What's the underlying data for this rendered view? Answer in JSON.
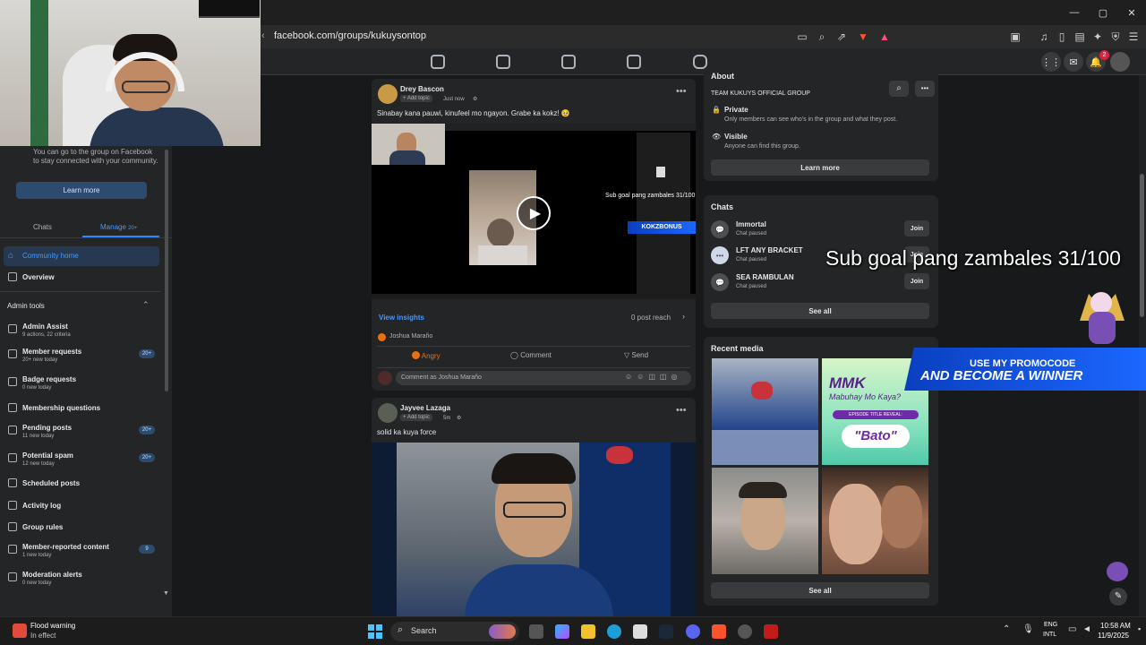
{
  "browser": {
    "url": "facebook.com/groups/kukuysontop",
    "url_lead": "‹",
    "window_controls": [
      "—",
      "▢",
      "✕"
    ],
    "ext_badge": "1"
  },
  "header": {
    "notif_count": "2"
  },
  "sidebar": {
    "info_text": "You can go to the group on Facebook to stay connected with your community.",
    "learn_more": "Learn more",
    "tabs": [
      {
        "label": "Chats"
      },
      {
        "label": "Manage",
        "count": "20+"
      }
    ],
    "community_home": "Community home",
    "overview": "Overview",
    "admin_tools": "Admin tools",
    "items": [
      {
        "label": "Admin Assist",
        "sub": "9 actions, 22 criteria",
        "badge": ""
      },
      {
        "label": "Member requests",
        "sub": "20+ new today",
        "badge": "20+"
      },
      {
        "label": "Badge requests",
        "sub": "0 new today",
        "badge": ""
      },
      {
        "label": "Membership questions",
        "sub": "",
        "badge": ""
      },
      {
        "label": "Pending posts",
        "sub": "11 new today",
        "badge": "20+"
      },
      {
        "label": "Potential spam",
        "sub": "12 new today",
        "badge": "20+"
      },
      {
        "label": "Scheduled posts",
        "sub": "",
        "badge": ""
      },
      {
        "label": "Activity log",
        "sub": "",
        "badge": ""
      },
      {
        "label": "Group rules",
        "sub": "",
        "badge": ""
      },
      {
        "label": "Member-reported content",
        "sub": "1 new today",
        "badge": "9"
      },
      {
        "label": "Moderation alerts",
        "sub": "0 new today",
        "badge": ""
      }
    ]
  },
  "posts": [
    {
      "author": "Drey Bascon",
      "add_topic": "+ Add topic",
      "time": "Just now",
      "text": "Sinabay kana pauwi, kinufeel mo ngayon. Grabe ka kokz! 🥹",
      "video_overlay_text": "Sub goal pang zambales 31/100",
      "video_badge": "KOKZBONUS",
      "view_insights": "View insights",
      "post_reach": "0 post reach",
      "reactor": "Joshua Maraño",
      "actions": [
        "Angry",
        "Comment",
        "Send"
      ],
      "comment_placeholder": "Comment as Joshua Maraño"
    },
    {
      "author": "Jayvee Lazaga",
      "add_topic": "+ Add topic",
      "time": "5m",
      "text": "solid ka kuya force"
    }
  ],
  "right": {
    "about_title": "About",
    "group_name": "TEAM KUKUYS OFFICIAL GROUP",
    "private_label": "Private",
    "private_desc": "Only members can see who's in the group and what they post.",
    "visible_label": "Visible",
    "visible_desc": "Anyone can find this group.",
    "learn_more": "Learn more",
    "chats_title": "Chats",
    "chats": [
      {
        "name": "Immortal",
        "status": "Chat paused",
        "action": "Join"
      },
      {
        "name": "LFT ANY BRACKET",
        "status": "Chat paused",
        "action": "Join"
      },
      {
        "name": "SEA RAMBULAN",
        "status": "Chat paused",
        "action": "Join"
      }
    ],
    "see_all": "See all",
    "recent_media_title": "Recent media",
    "media": [
      {
        "caption": ""
      },
      {
        "caption": "MMK Mabuhay Mo Kaya? EPISODE TITLE REVEAL: \"Bato\""
      },
      {
        "caption": ""
      },
      {
        "caption": ""
      }
    ],
    "see_all_media": "See all"
  },
  "overlays": {
    "sub_goal": "Sub goal pang zambales 31/100",
    "promo_line1": "USE MY PROMOCODE",
    "promo_line2": "AND BECOME A WINNER"
  },
  "taskbar": {
    "weather_title": "Flood warning",
    "weather_sub": "In effect",
    "search": "Search",
    "lang1": "ENG",
    "lang2": "INTL",
    "time": "10:58 AM",
    "date": "11/9/2025"
  }
}
